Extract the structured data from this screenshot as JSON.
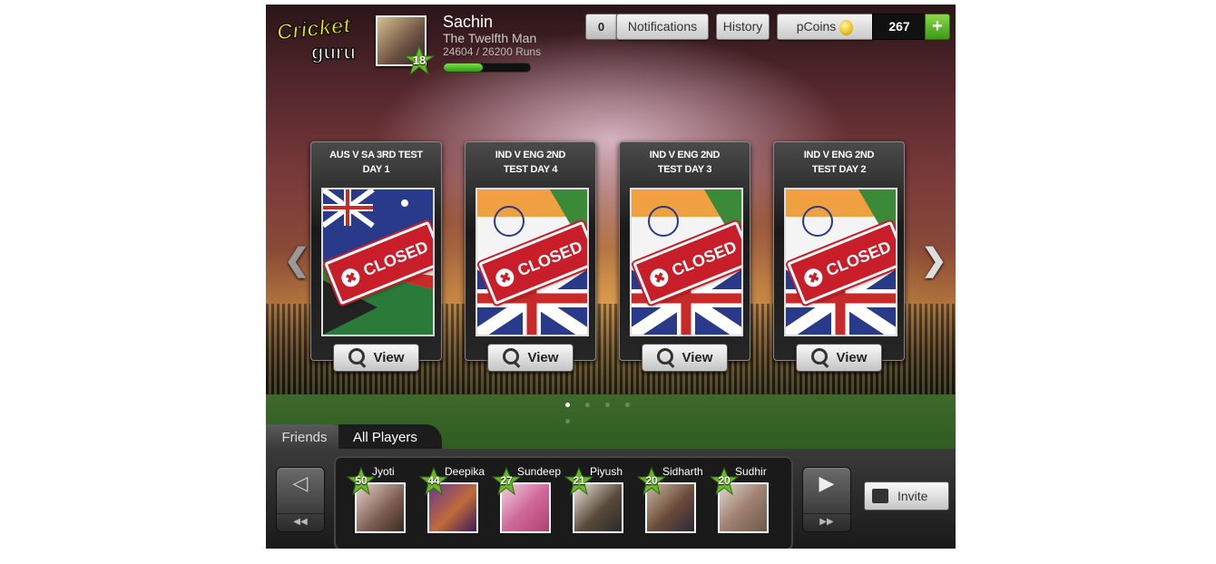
{
  "header": {
    "logo_text": "Cricket Guru",
    "user_name": "Sachin",
    "user_title": "The Twelfth Man",
    "runs_text": "24604 / 26200 Runs",
    "runs_progress_pct": 45,
    "level": "18",
    "notifications_count": "0",
    "notifications_label": "Notifications",
    "history_label": "History",
    "pcoins_label": "pCoins",
    "pcoins_value": "267",
    "add_coins_label": "+"
  },
  "cards": [
    {
      "title_line1": "AUS V SA 3RD TEST",
      "title_line2": "DAY 1",
      "status": "CLOSED",
      "view_label": "View",
      "flags": "aus-sa"
    },
    {
      "title_line1": "IND V ENG 2ND",
      "title_line2": "TEST DAY 4",
      "status": "CLOSED",
      "view_label": "View",
      "flags": "ind-eng"
    },
    {
      "title_line1": "IND V ENG 2ND",
      "title_line2": "TEST DAY 3",
      "status": "CLOSED",
      "view_label": "View",
      "flags": "ind-eng"
    },
    {
      "title_line1": "IND V ENG 2ND",
      "title_line2": "TEST DAY 2",
      "status": "CLOSED",
      "view_label": "View",
      "flags": "ind-eng"
    }
  ],
  "nav": {
    "prev_icon": "chevron-left-icon",
    "next_icon": "chevron-right-icon",
    "page_count": 5,
    "active_page": 1
  },
  "tabs": {
    "friends": "Friends",
    "all_players": "All Players"
  },
  "players": [
    {
      "name": "Jyoti",
      "level": "50"
    },
    {
      "name": "Deepika",
      "level": "44"
    },
    {
      "name": "Sundeep",
      "level": "27"
    },
    {
      "name": "Piyush",
      "level": "21"
    },
    {
      "name": "Sidharth",
      "level": "20"
    },
    {
      "name": "Sudhir",
      "level": "20"
    }
  ],
  "bottom": {
    "invite_label": "Invite",
    "prev_glyph": "◁",
    "prev_fast": "◀◀",
    "next_glyph": "▶",
    "next_fast": "▶▶"
  },
  "colors": {
    "accent_green": "#3c9a18",
    "closed_red": "#c81e2a"
  }
}
